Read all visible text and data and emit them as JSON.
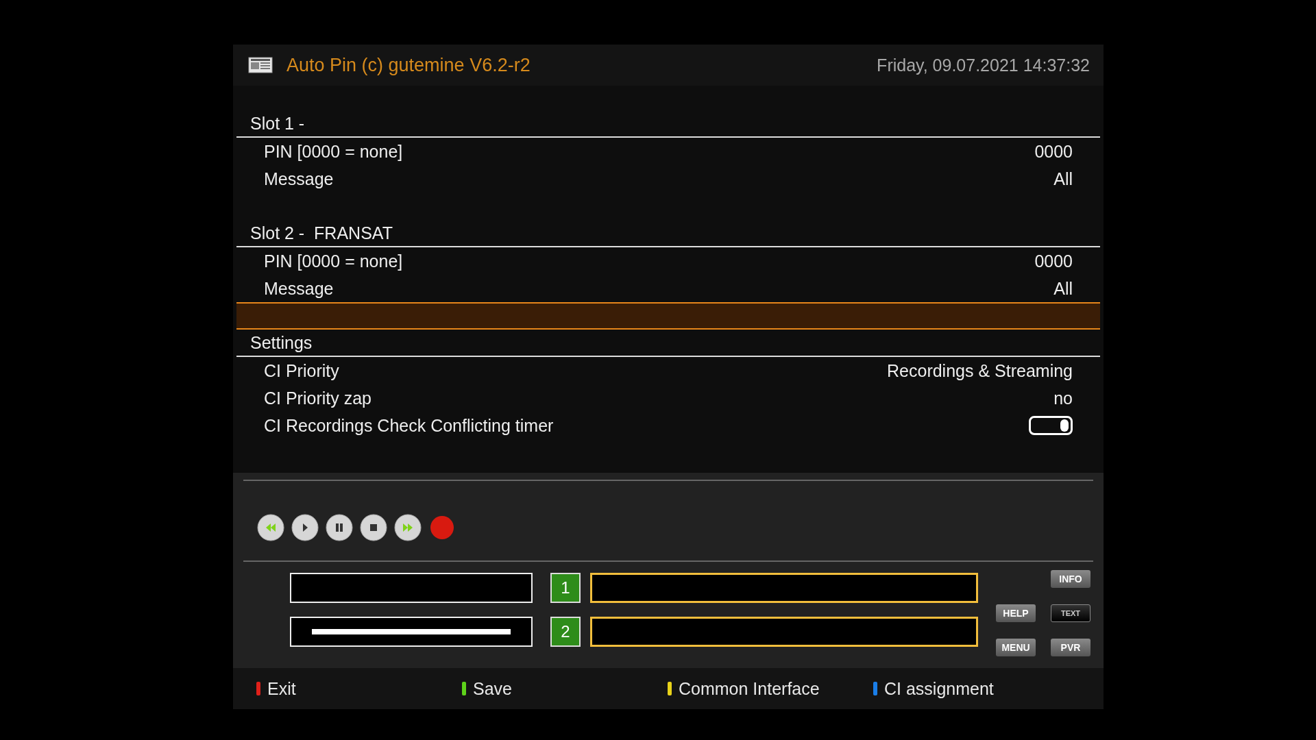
{
  "header": {
    "title": "Auto Pin (c) gutemine V6.2-r2",
    "datetime": "Friday, 09.07.2021  14:37:32"
  },
  "rows": [
    {
      "kind": "section",
      "label": "Slot 1 -",
      "selected": false
    },
    {
      "kind": "value",
      "label": "PIN [0000 = none]",
      "value": "0000",
      "selected": false
    },
    {
      "kind": "value",
      "label": "Message",
      "value": "All",
      "selected": false
    },
    {
      "kind": "spacer",
      "selected": false
    },
    {
      "kind": "section",
      "label": "Slot 2 -  FRANSAT",
      "selected": false
    },
    {
      "kind": "value",
      "label": "PIN [0000 = none]",
      "value": "0000",
      "selected": false
    },
    {
      "kind": "value",
      "label": "Message",
      "value": "All",
      "selected": false
    },
    {
      "kind": "spacer",
      "selected": true
    },
    {
      "kind": "section",
      "label": "Settings",
      "selected": false
    },
    {
      "kind": "value",
      "label": "CI Priority",
      "value": "Recordings & Streaming",
      "selected": false
    },
    {
      "kind": "value",
      "label": "CI Priority zap",
      "value": "no",
      "selected": false
    },
    {
      "kind": "toggle",
      "label": "CI Recordings Check Conflicting timer",
      "on": true,
      "selected": false
    }
  ],
  "slots": [
    {
      "number": "1"
    },
    {
      "number": "2"
    }
  ],
  "keys": [
    {
      "label": "INFO",
      "kind": "grey"
    },
    {
      "label": "HELP",
      "kind": "grey"
    },
    {
      "label": "TEXT",
      "kind": "dark"
    },
    {
      "label": "MENU",
      "kind": "grey"
    },
    {
      "label": "PVR",
      "kind": "grey"
    }
  ],
  "footer": [
    {
      "label": "Exit",
      "color": "#e0201a"
    },
    {
      "label": "Save",
      "color": "#5ed21a"
    },
    {
      "label": "Common Interface",
      "color": "#e8d21a"
    },
    {
      "label": "CI assignment",
      "color": "#1a7ee8"
    }
  ]
}
